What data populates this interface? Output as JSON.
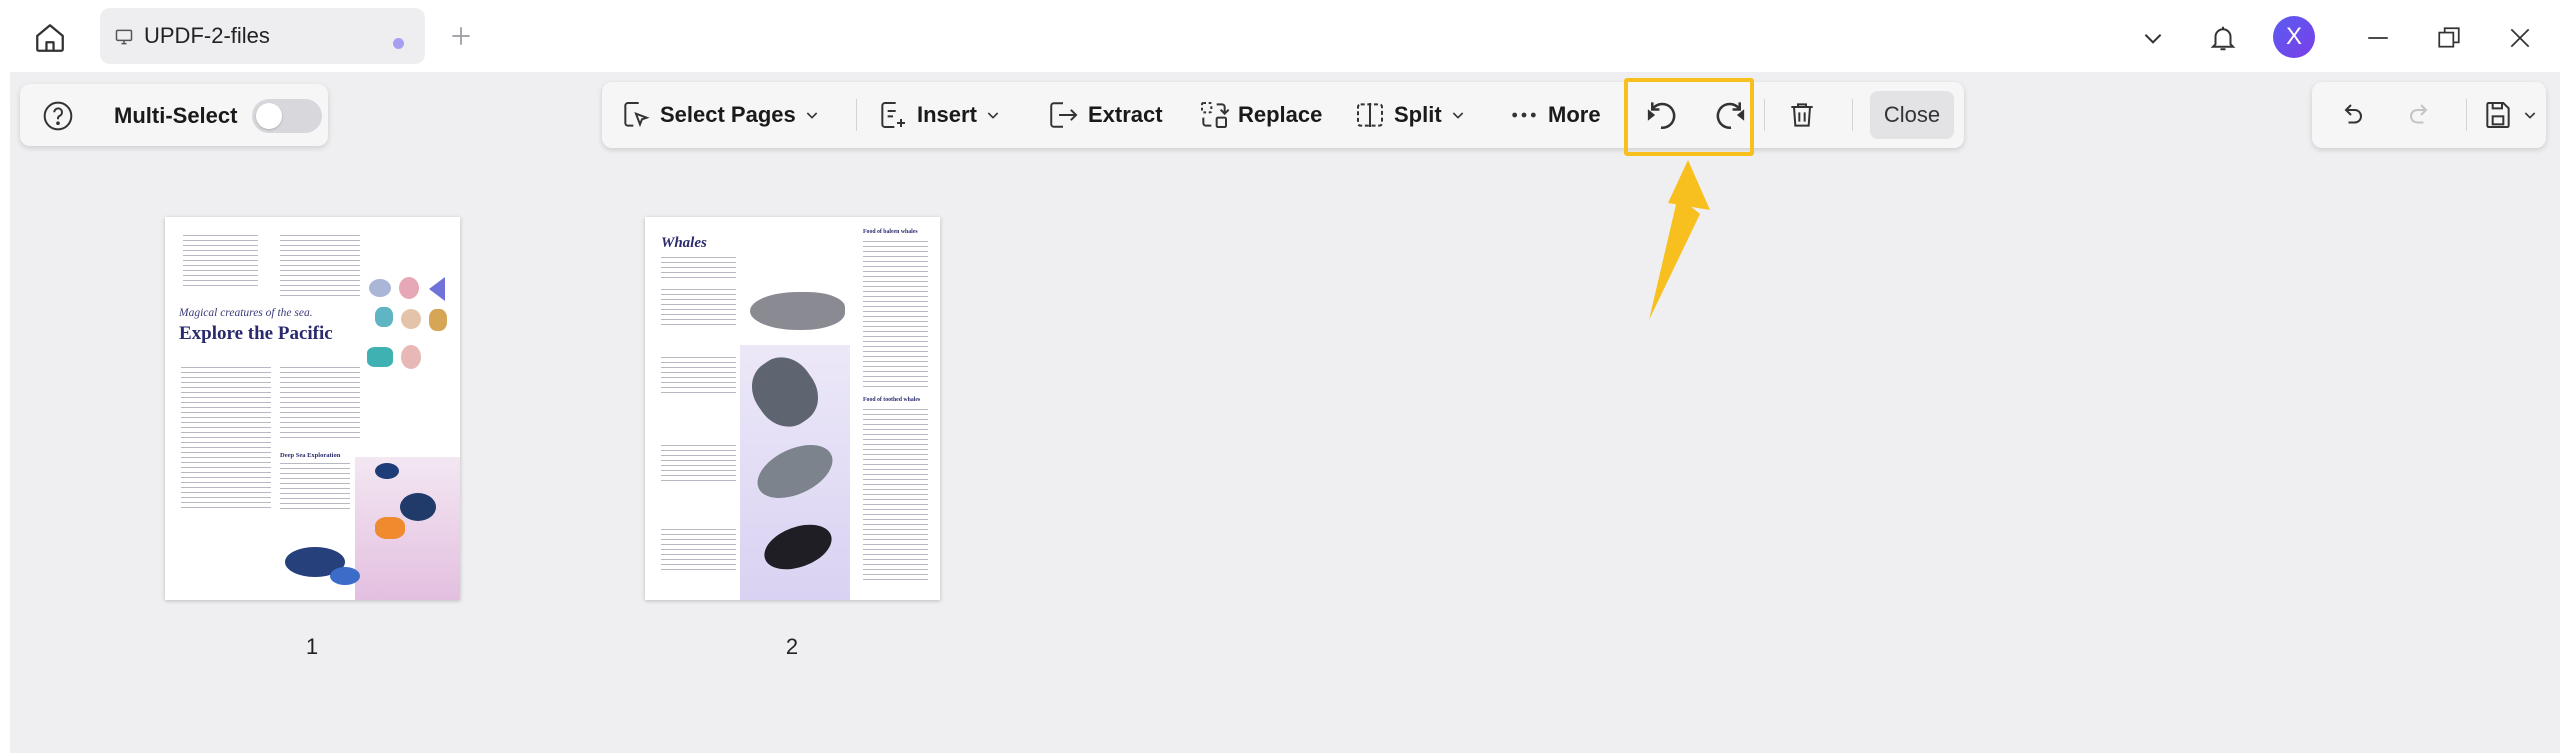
{
  "titlebar": {
    "tab_title": "UPDF-2-files",
    "avatar_initial": "X",
    "icons": [
      "home-icon",
      "monitor-icon",
      "plus-icon",
      "chevron-down-icon",
      "bell-icon",
      "minimize-icon",
      "restore-icon",
      "close-icon"
    ]
  },
  "left_panel": {
    "multi_select_label": "Multi-Select",
    "multi_select_on": false
  },
  "toolbar": {
    "select_pages": "Select Pages",
    "insert": "Insert",
    "extract": "Extract",
    "replace": "Replace",
    "split": "Split",
    "more": "More",
    "close": "Close",
    "highlight_color": "#f7c01e"
  },
  "pages": [
    {
      "number": "1",
      "subtitle": "Magical creatures of the sea.",
      "title": "Explore the Pacific",
      "section": "Deep Sea Exploration"
    },
    {
      "number": "2",
      "title": "Whales",
      "section_a": "Food of baleen whales",
      "section_b": "Food of toothed whales"
    }
  ],
  "colors": {
    "accent": "#5b5cf0",
    "workspace_bg": "#efeff1",
    "page_title": "#2a2a6e"
  }
}
